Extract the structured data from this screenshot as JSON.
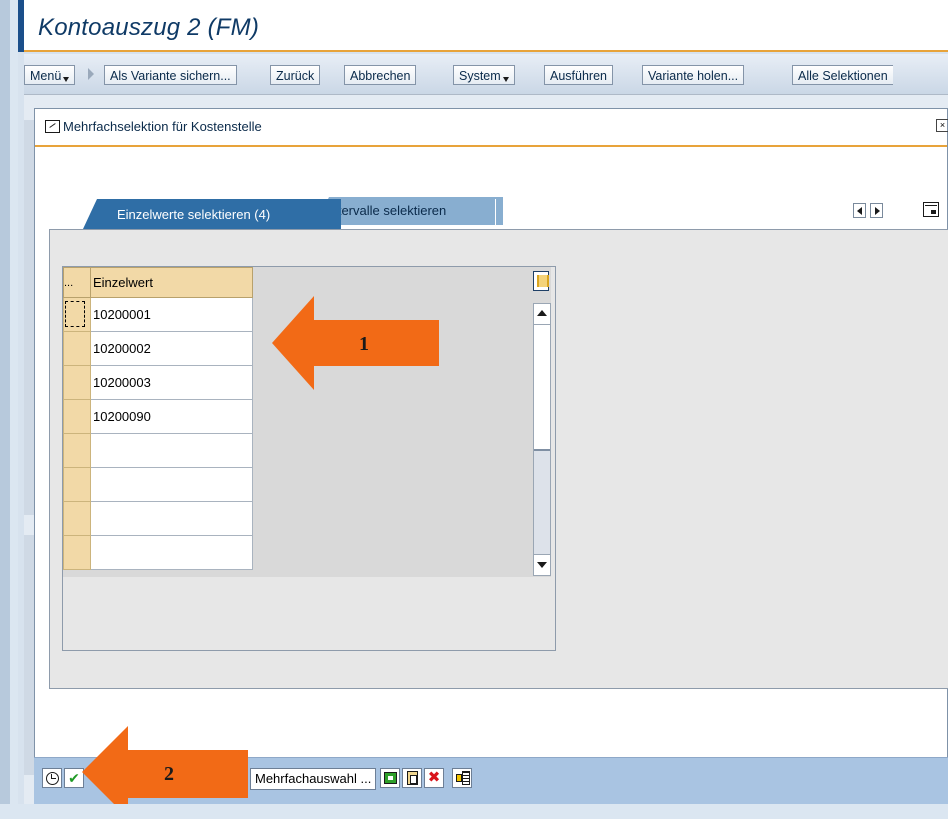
{
  "window": {
    "title": "Kontoauszug 2 (FM)"
  },
  "toolbar": {
    "menu": "Menü",
    "save_variant": "Als Variante sichern...",
    "back": "Zurück",
    "cancel": "Abbrechen",
    "system": "System",
    "execute": "Ausführen",
    "get_variant": "Variante holen...",
    "all_selections": "Alle Selektionen"
  },
  "dialog": {
    "title": "Mehrfachselektion für Kostenstelle",
    "tabs": [
      {
        "label": "Einzelwerte selektieren (4)",
        "active": true
      },
      {
        "label": "Intervalle selektieren",
        "active": false
      }
    ],
    "table": {
      "header_selector": "...",
      "column": "Einzelwert",
      "rows": [
        "10200001",
        "10200002",
        "10200003",
        "10200090",
        "",
        "",
        "",
        ""
      ]
    },
    "bottom": {
      "multiple_selection": "Mehrfachauswahl ..."
    }
  },
  "annotations": [
    {
      "number": "1",
      "color": "#f26a16"
    },
    {
      "number": "2",
      "color": "#f26a16"
    }
  ],
  "colors": {
    "accent": "#e8a33a",
    "tab_active": "#2f6ea6",
    "title_text": "#0f3a66"
  }
}
